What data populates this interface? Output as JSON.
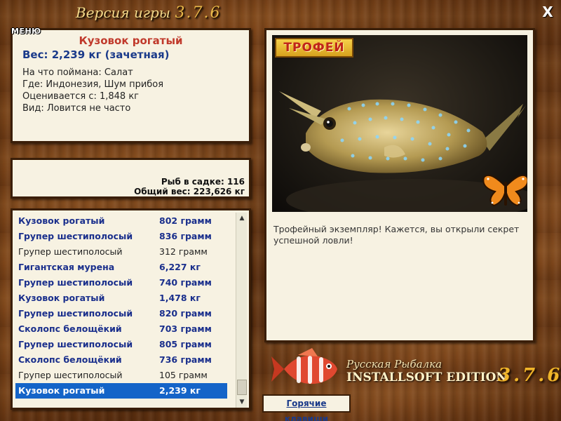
{
  "window": {
    "title_prefix": "Версия игры",
    "title_version": "3.7.6",
    "close_label": "X"
  },
  "fish_info": {
    "name": "Кузовок рогатый",
    "weight_line": "Вес: 2,239 кг (зачетная)",
    "bait_line": "На что поймана: Салат",
    "location_line": "Где: Индонезия, Шум прибоя",
    "valued_line": "Оценивается с: 1,848 кг",
    "type_line": "Вид: Ловится не часто"
  },
  "cage": {
    "menu_label": "МЕНЮ",
    "count_line": "Рыб в садке: 116",
    "total_line": "Общий вес: 223,626 кг"
  },
  "catch_list": [
    {
      "name": "Кузовок рогатый",
      "weight": "802 грамм",
      "bold": true
    },
    {
      "name": "Групер шестиполосый",
      "weight": "836 грамм",
      "bold": true
    },
    {
      "name": "Групер шестиполосый",
      "weight": "312 грамм",
      "bold": false
    },
    {
      "name": "Гигантская мурена",
      "weight": "6,227 кг",
      "bold": true
    },
    {
      "name": "Групер шестиполосый",
      "weight": "740 грамм",
      "bold": true
    },
    {
      "name": "Кузовок рогатый",
      "weight": "1,478 кг",
      "bold": true
    },
    {
      "name": "Групер шестиполосый",
      "weight": "820 грамм",
      "bold": true
    },
    {
      "name": "Сколопс белощёкий",
      "weight": "703 грамм",
      "bold": true
    },
    {
      "name": "Групер шестиполосый",
      "weight": "805 грамм",
      "bold": true
    },
    {
      "name": "Сколопс белощёкий",
      "weight": "736 грамм",
      "bold": true
    },
    {
      "name": "Групер шестиполосый",
      "weight": "105 грамм",
      "bold": false
    },
    {
      "name": "Кузовок рогатый",
      "weight": "2,239 кг",
      "bold": true,
      "selected": true
    }
  ],
  "photo": {
    "badge": "ТРОФЕЙ",
    "description": "Трофейный экземпляр! Кажется, вы открыли секрет успешной ловли!"
  },
  "brand": {
    "line1": "Русская Рыбалка",
    "line2": "INSTALLSOFT EDITION",
    "version": "3.7.6"
  },
  "hotkeys_label": "Горячие клавиши",
  "colors": {
    "wood": "#6b3a14",
    "panel": "#f7f2e2",
    "fish_title": "#c0392b",
    "link_blue": "#1a3a8a",
    "selected": "#1464c8",
    "version_gold": "#f0b52a"
  }
}
